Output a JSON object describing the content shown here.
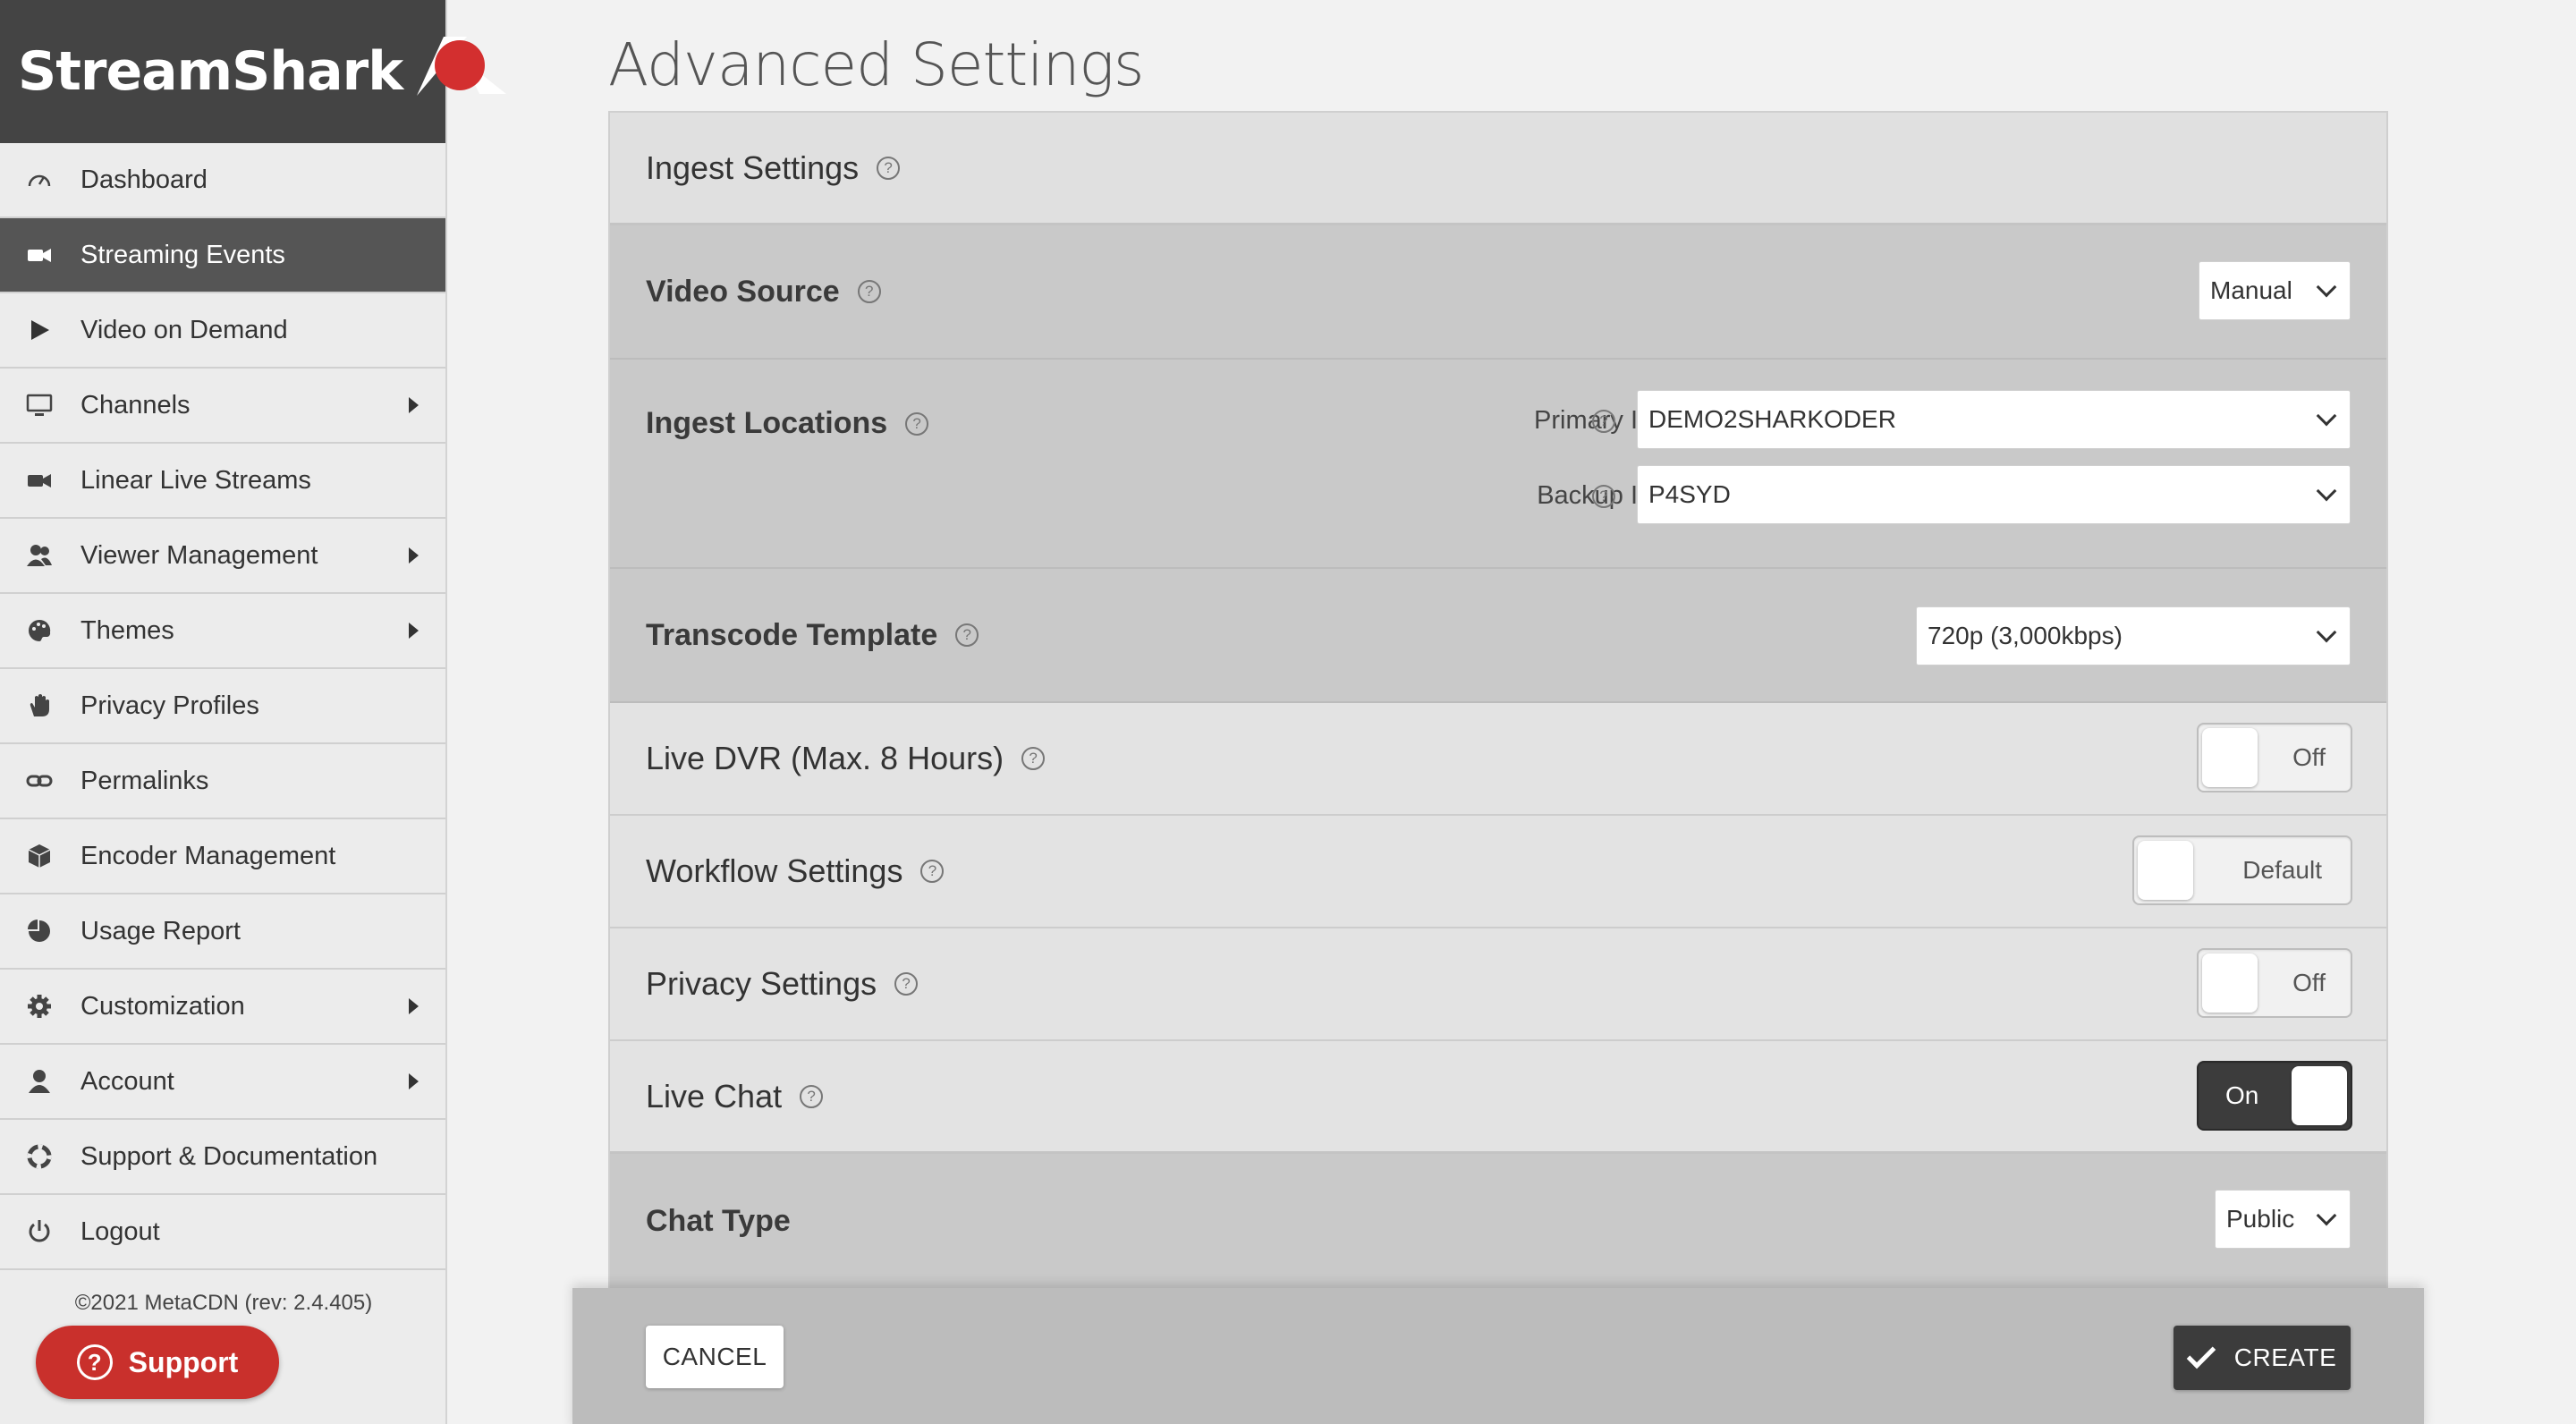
{
  "app": {
    "name": "StreamShark",
    "brand_color": "#d32f2f"
  },
  "sidebar": {
    "items": [
      {
        "label": "Dashboard",
        "icon": "gauge-icon",
        "active": false,
        "has_submenu": false
      },
      {
        "label": "Streaming Events",
        "icon": "video-camera-icon",
        "active": true,
        "has_submenu": false
      },
      {
        "label": "Video on Demand",
        "icon": "play-icon",
        "active": false,
        "has_submenu": false
      },
      {
        "label": "Channels",
        "icon": "monitor-icon",
        "active": false,
        "has_submenu": true
      },
      {
        "label": "Linear Live Streams",
        "icon": "video-camera-icon",
        "active": false,
        "has_submenu": false
      },
      {
        "label": "Viewer Management",
        "icon": "users-icon",
        "active": false,
        "has_submenu": true
      },
      {
        "label": "Themes",
        "icon": "palette-icon",
        "active": false,
        "has_submenu": true
      },
      {
        "label": "Privacy Profiles",
        "icon": "hand-icon",
        "active": false,
        "has_submenu": false
      },
      {
        "label": "Permalinks",
        "icon": "link-icon",
        "active": false,
        "has_submenu": false
      },
      {
        "label": "Encoder Management",
        "icon": "cube-icon",
        "active": false,
        "has_submenu": false
      },
      {
        "label": "Usage Report",
        "icon": "pie-chart-icon",
        "active": false,
        "has_submenu": false
      },
      {
        "label": "Customization",
        "icon": "gear-icon",
        "active": false,
        "has_submenu": true
      },
      {
        "label": "Account",
        "icon": "user-icon",
        "active": false,
        "has_submenu": true
      },
      {
        "label": "Support & Documentation",
        "icon": "lifebuoy-icon",
        "active": false,
        "has_submenu": false
      },
      {
        "label": "Logout",
        "icon": "power-icon",
        "active": false,
        "has_submenu": false
      }
    ],
    "copyright": "©2021 MetaCDN (rev: 2.4.405)",
    "support_label": "Support"
  },
  "page": {
    "title": "Advanced Settings"
  },
  "settings": {
    "ingest_header": "Ingest Settings",
    "video_source": {
      "label": "Video Source",
      "value": "Manual"
    },
    "ingest_locations": {
      "label": "Ingest Locations",
      "primary_label": "Primary Ingest",
      "primary_value": "DEMO2SHARKODER",
      "backup_label": "Backup Ingest",
      "backup_value": "P4SYD"
    },
    "transcode": {
      "label": "Transcode Template",
      "value": "720p (3,000kbps)"
    },
    "live_dvr": {
      "label": "Live DVR (Max. 8 Hours)",
      "state": "Off"
    },
    "workflow": {
      "label": "Workflow Settings",
      "state": "Default"
    },
    "privacy": {
      "label": "Privacy Settings",
      "state": "Off"
    },
    "live_chat": {
      "label": "Live Chat",
      "state": "On"
    },
    "chat_type": {
      "label": "Chat Type",
      "value": "Public"
    }
  },
  "footer": {
    "cancel_label": "CANCEL",
    "create_label": "CREATE"
  }
}
